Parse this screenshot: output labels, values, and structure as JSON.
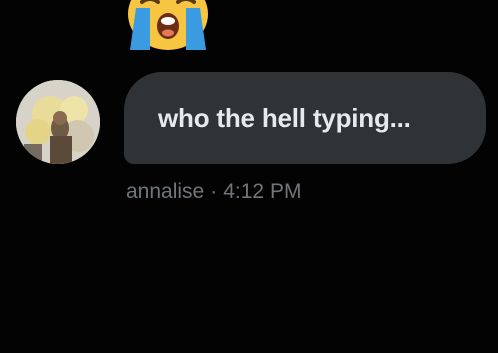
{
  "message": {
    "reaction_icon": "loudly-crying-face",
    "sender_avatar": "avatar",
    "text": "who the hell typing...",
    "sender_name": "annalise",
    "separator": "·",
    "timestamp": "4:12 PM"
  },
  "colors": {
    "background": "#030303",
    "bubble": "#2f3336",
    "text": "#e7e9ea",
    "meta": "#71767b"
  }
}
